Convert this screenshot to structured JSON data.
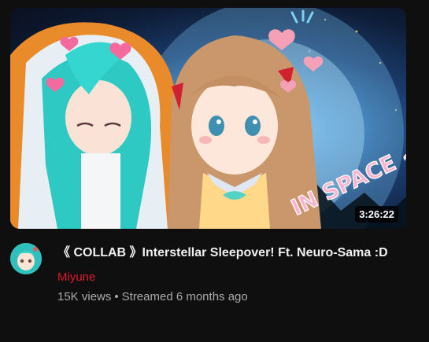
{
  "video": {
    "duration": "3:26:22",
    "title": "《 COLLAB 》Interstellar Sleepover! Ft. Neuro-Sama :D",
    "thumbnail_text": "IN SPACE ~!",
    "channel": "Miyune",
    "views": "15K views",
    "separator": "•",
    "streamed": "Streamed 6 months ago"
  },
  "colors": {
    "channel_name": "#e3162d",
    "title": "#f1f1f1",
    "secondary": "#aaaaaa",
    "background": "#0f0f0f"
  }
}
